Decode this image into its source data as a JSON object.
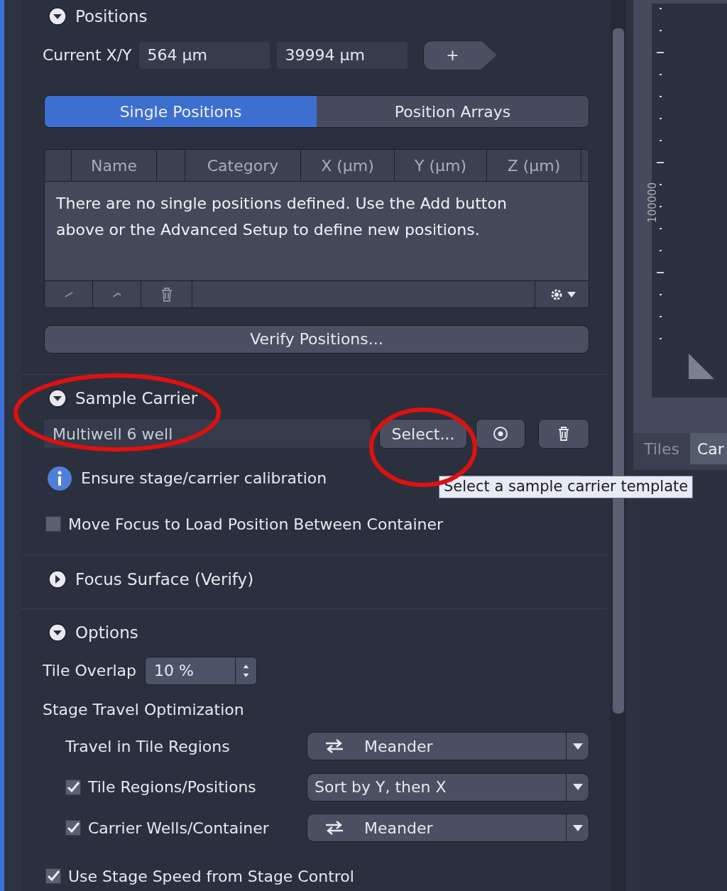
{
  "positions": {
    "title": "Positions",
    "expanded": true,
    "current_label": "Current X/Y",
    "x_value": "564 µm",
    "y_value": "39994 µm",
    "add_button": "+",
    "tabs": [
      {
        "label": "Single Positions",
        "selected": true
      },
      {
        "label": "Position Arrays",
        "selected": false
      }
    ],
    "table": {
      "columns": [
        "",
        "Name",
        "",
        "Category",
        "X (µm)",
        "Y (µm)",
        "Z (µm)"
      ],
      "empty_message": "There are no single positions defined. Use the Add button above or the Advanced Setup to define new positions."
    },
    "verify_button": "Verify Positions..."
  },
  "sample_carrier": {
    "title": "Sample Carrier",
    "expanded": true,
    "carrier": "Multiwell 6 well",
    "select_button": "Select...",
    "info": "Ensure stage/carrier calibration",
    "move_focus": {
      "label": "Move Focus to Load Position Between Container",
      "checked": false
    }
  },
  "focus_surface": {
    "title": "Focus Surface (Verify)",
    "expanded": false
  },
  "options": {
    "title": "Options",
    "expanded": true,
    "tile_overlap_label": "Tile Overlap",
    "tile_overlap": "10 %",
    "stage_travel_title": "Stage Travel Optimization",
    "travel_rows": [
      {
        "kind": "plain",
        "label": "Travel in Tile Regions",
        "value": "Meander",
        "meander": true
      },
      {
        "kind": "checkbox",
        "label": "Tile Regions/Positions",
        "checked": true,
        "value": "Sort by Y, then X",
        "meander": false
      },
      {
        "kind": "checkbox",
        "label": "Carrier Wells/Container",
        "checked": true,
        "value": "Meander",
        "meander": true
      }
    ],
    "stage_speed": {
      "label": "Use Stage Speed from Stage Control",
      "checked": true
    }
  },
  "right_panel": {
    "ruler_label": "100000",
    "tabs": [
      {
        "label": "Tiles",
        "selected": false
      },
      {
        "label": "Car",
        "selected": true
      }
    ]
  },
  "tooltip": "Select a sample carrier template"
}
